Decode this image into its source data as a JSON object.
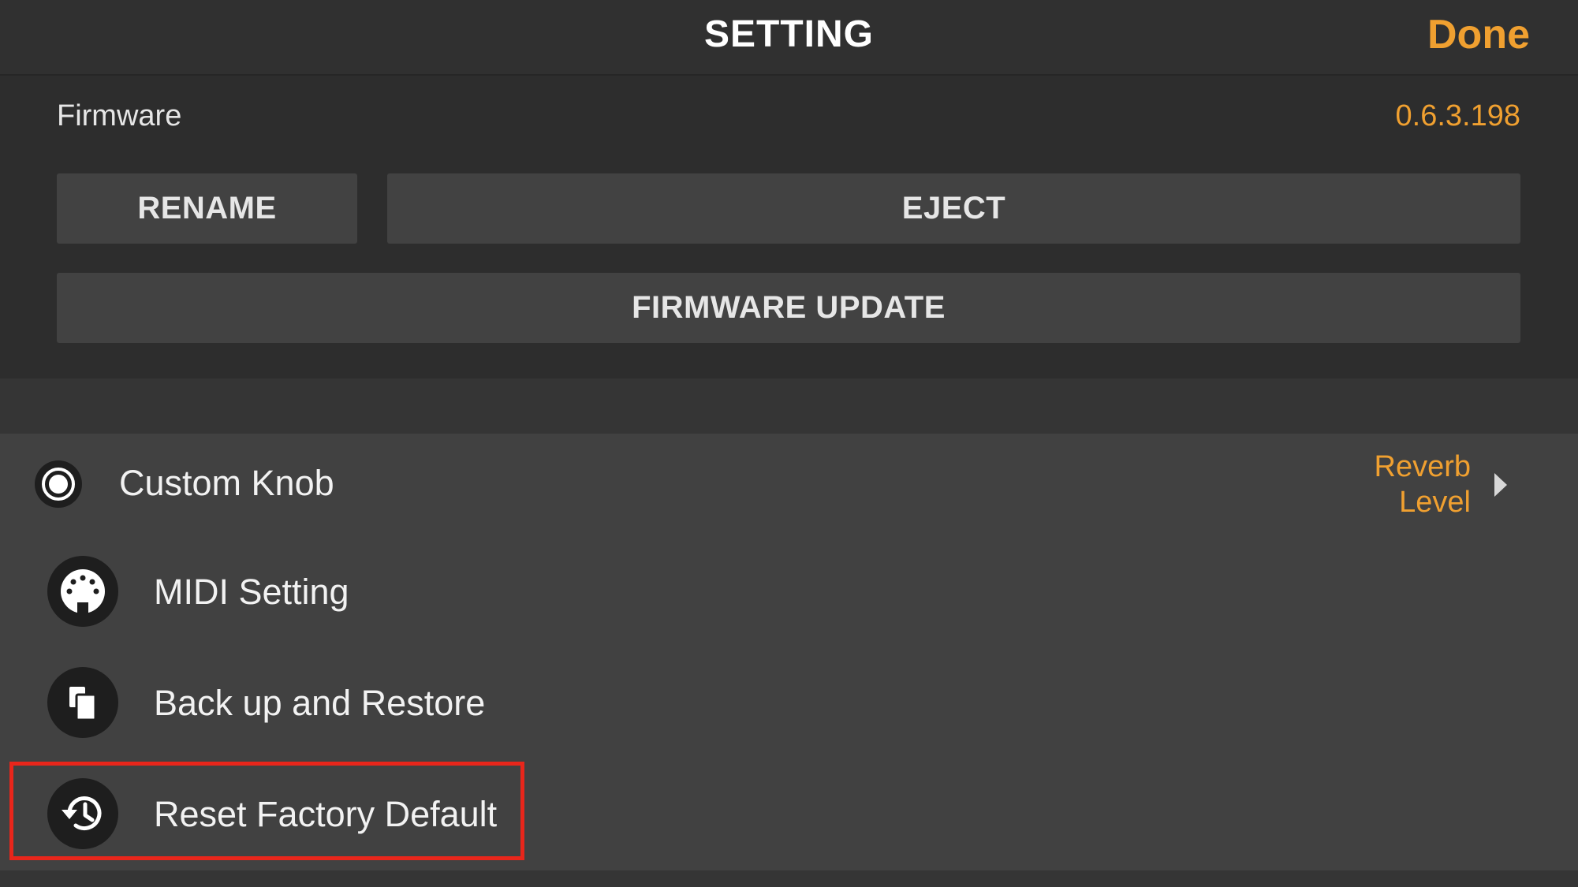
{
  "header": {
    "title": "SETTING",
    "done_label": "Done"
  },
  "device": {
    "firmware_label": "Firmware",
    "firmware_version": "0.6.3.198",
    "rename_label": "RENAME",
    "eject_label": "EJECT",
    "firmware_update_label": "FIRMWARE UPDATE"
  },
  "settings": {
    "custom_knob": {
      "label": "Custom Knob",
      "value_line1": "Reverb",
      "value_line2": "Level",
      "icon": "knob-icon"
    },
    "items": [
      {
        "label": "MIDI Setting",
        "icon": "midi-icon"
      },
      {
        "label": "Back up and Restore",
        "icon": "copy-icon"
      },
      {
        "label": "Reset Factory Default",
        "icon": "history-icon"
      }
    ]
  },
  "colors": {
    "accent": "#f0a030",
    "highlight": "#e8261b",
    "background": "#2b2b2b",
    "list_background": "#414141"
  }
}
